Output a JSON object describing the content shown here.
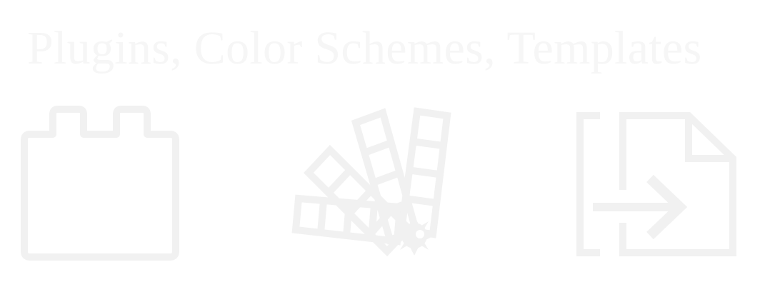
{
  "header": {
    "title": "Plugins, Color Schemes, Templates"
  },
  "icons": [
    {
      "name": "plugin-icon",
      "label": "Plugins"
    },
    {
      "name": "color-swatch-icon",
      "label": "Color Schemes"
    },
    {
      "name": "import-file-icon",
      "label": "Templates"
    }
  ],
  "colors": {
    "background": "#ffffff",
    "title_text": "#f6f6f6",
    "icon_stroke": "#f1f1f1"
  }
}
